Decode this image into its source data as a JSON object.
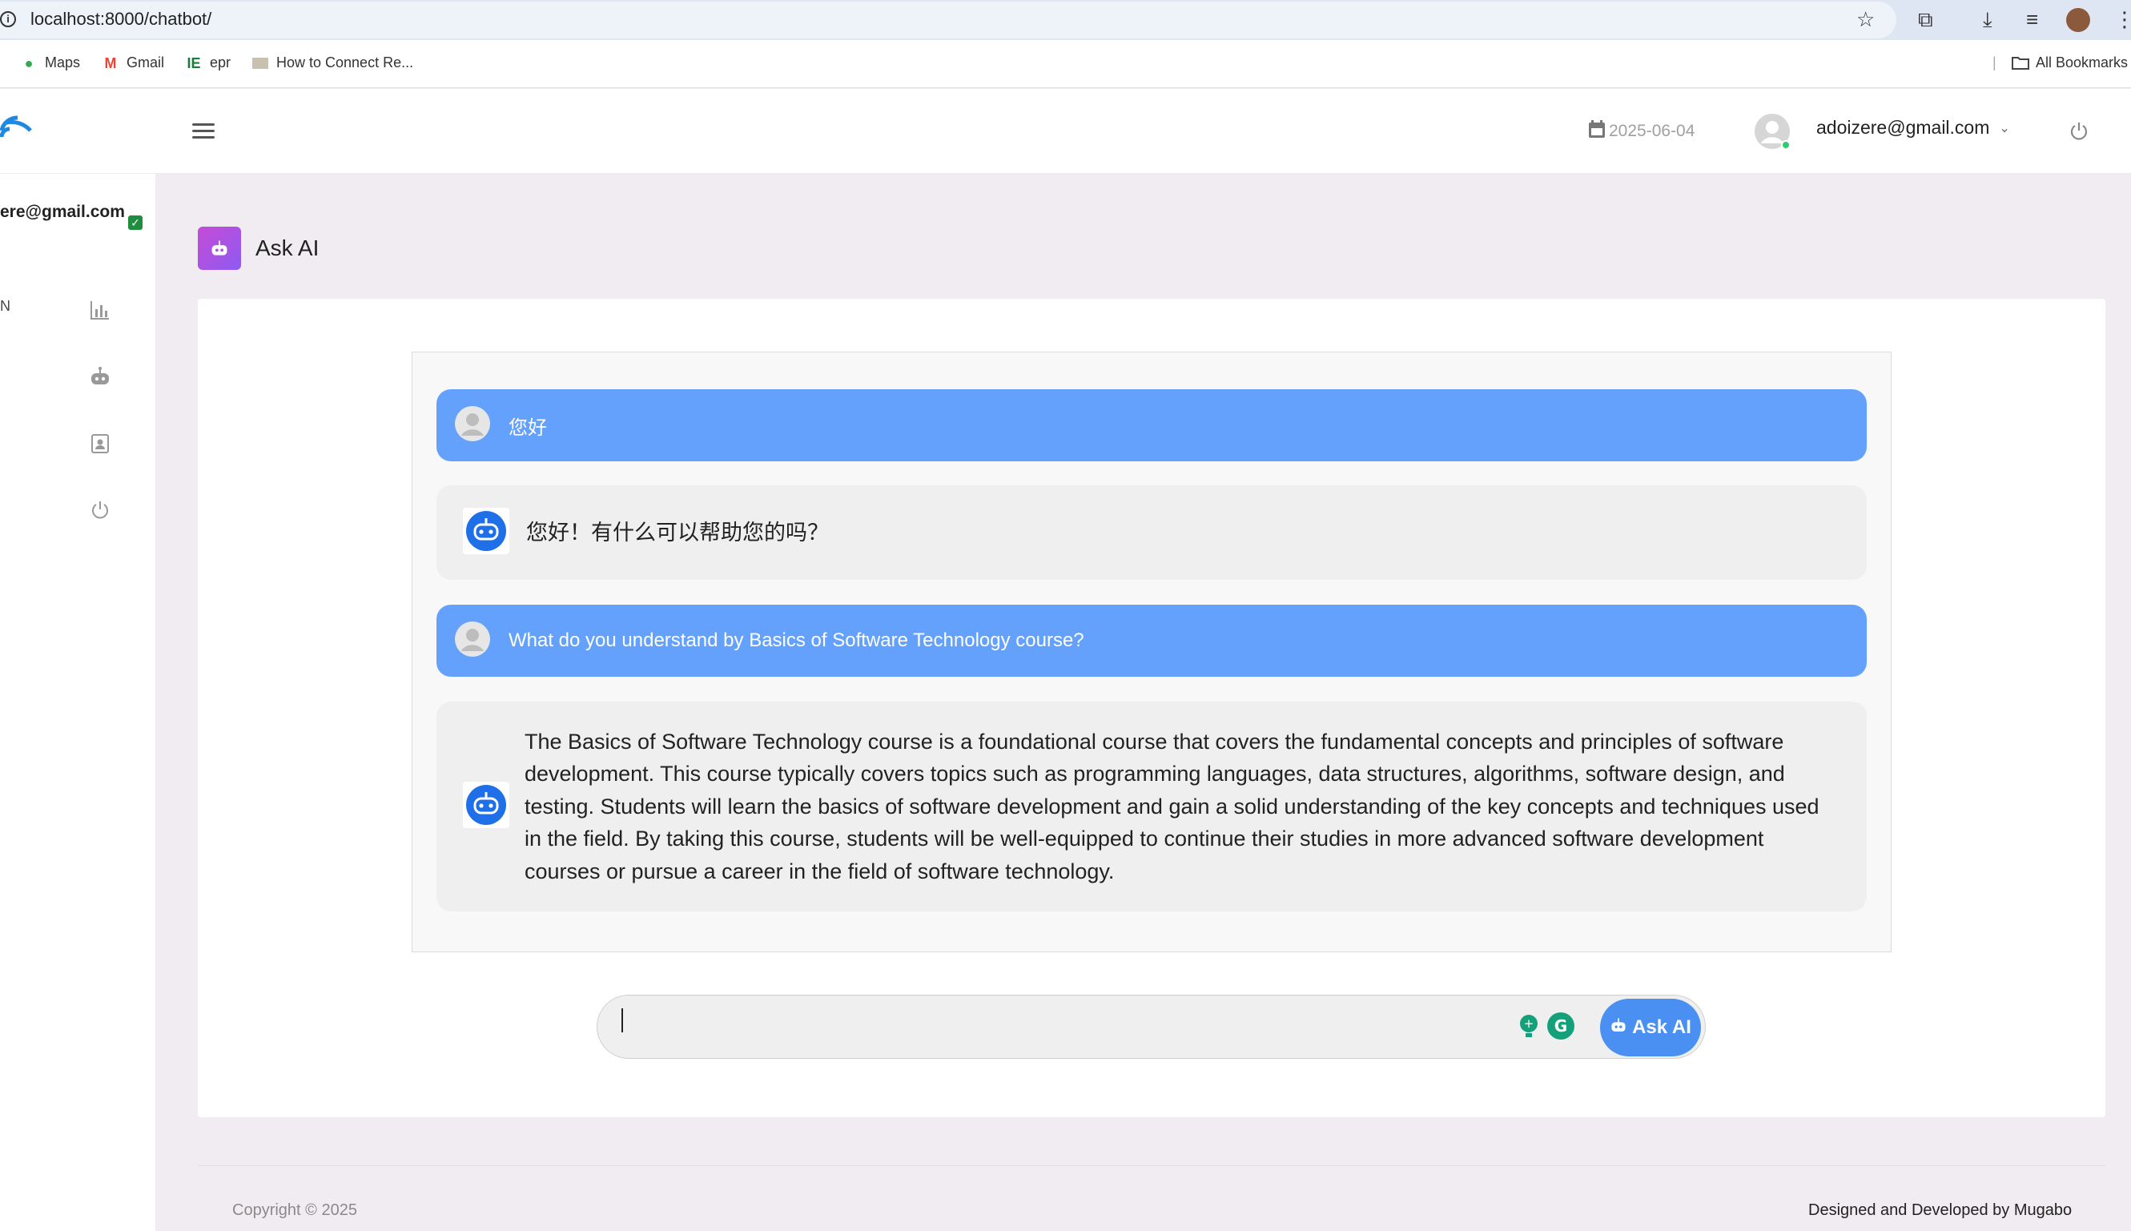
{
  "browser": {
    "url": "localhost:8000/chatbot/",
    "bookmarks": [
      {
        "label": "Maps",
        "icon": "maps-pin-icon"
      },
      {
        "label": "Gmail",
        "icon": "gmail-icon"
      },
      {
        "label": "epr",
        "icon": "ie-icon"
      },
      {
        "label": "How to Connect Re...",
        "icon": "page-thumbnail-icon"
      }
    ],
    "all_bookmarks": "All Bookmarks"
  },
  "header": {
    "date": "2025-06-04",
    "user_email": "adoizere@gmail.com"
  },
  "sidebar": {
    "email_fragment": "ere@gmail.com",
    "fragment_letter": "N",
    "items": [
      {
        "icon": "bar-chart-icon"
      },
      {
        "icon": "robot-icon"
      },
      {
        "icon": "contact-card-icon"
      },
      {
        "icon": "power-icon"
      }
    ]
  },
  "page": {
    "title": "Ask AI"
  },
  "chat": {
    "messages": [
      {
        "role": "user",
        "text": "您好"
      },
      {
        "role": "bot",
        "text": "您好！有什么可以帮助您的吗？"
      },
      {
        "role": "user",
        "text": "What do you understand by Basics of Software Technology course?"
      },
      {
        "role": "bot",
        "text": "The Basics of Software Technology course is a foundational course that covers the fundamental concepts and principles of software development. This course typically covers topics such as programming languages, data structures, algorithms, software design, and testing. Students will learn the basics of software development and gain a solid understanding of the key concepts and techniques used in the field. By taking this course, students will be well-equipped to continue their studies in more advanced software development courses or pursue a career in the field of software technology."
      }
    ]
  },
  "input": {
    "value": "",
    "button_label": "Ask AI"
  },
  "footer": {
    "copyright": "Copyright © 2025",
    "credit": "Designed and Developed by Mugabo"
  },
  "colors": {
    "user_bubble": "#63a1fc",
    "bot_bubble": "#efefef",
    "ask_button": "#4a90f2",
    "page_badge": "#b04fe2",
    "background": "#f1ecf1"
  }
}
